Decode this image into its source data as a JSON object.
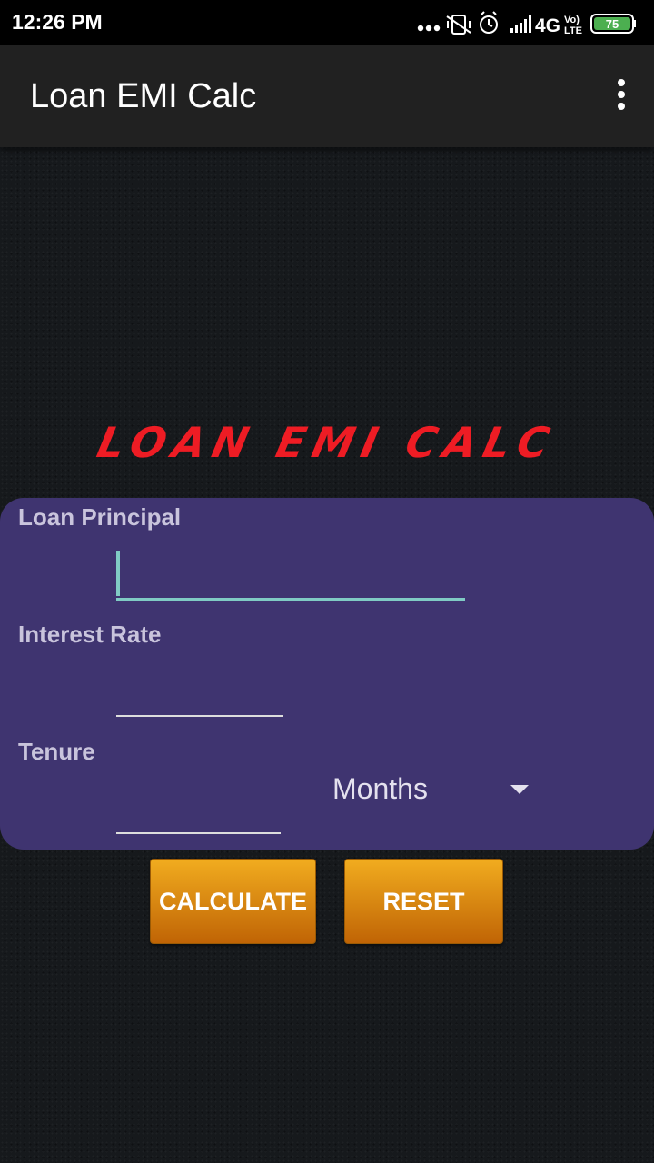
{
  "status_bar": {
    "time": "12:26 PM",
    "network": "4G",
    "volte_top": "Vo)",
    "volte_bottom": "LTE",
    "battery": "75"
  },
  "app_bar": {
    "title": "Loan EMI Calc"
  },
  "heading": "LOAN EMI CALC",
  "form": {
    "principal_label": "Loan Principal",
    "principal_value": "",
    "interest_label": "Interest Rate",
    "interest_value": "",
    "tenure_label": "Tenure",
    "tenure_value": "",
    "tenure_unit": "Months"
  },
  "buttons": {
    "calculate": "CALCULATE",
    "reset": "RESET"
  },
  "colors": {
    "app_bar": "#212121",
    "form_card": "#3f3470",
    "heading_red": "#ee1c24",
    "input_accent": "#80cbc4",
    "button_orange": "#e08a12"
  }
}
